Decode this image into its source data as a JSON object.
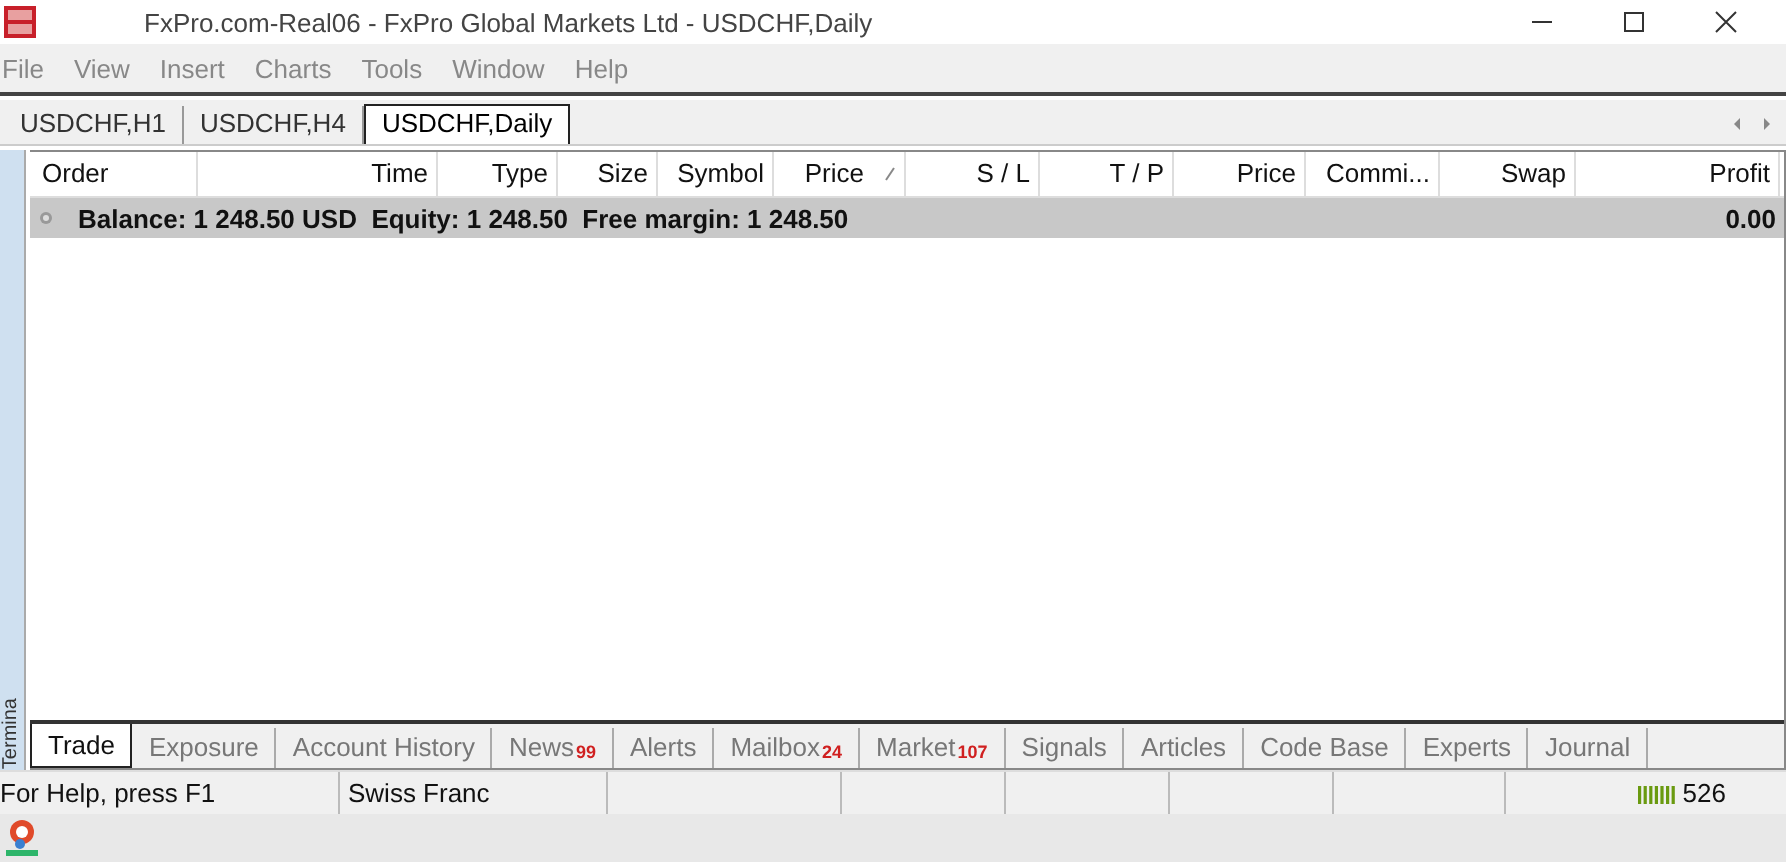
{
  "window": {
    "title": "FxPro.com-Real06 - FxPro Global Markets Ltd - USDCHF,Daily"
  },
  "menu": [
    "File",
    "View",
    "Insert",
    "Charts",
    "Tools",
    "Window",
    "Help"
  ],
  "chart_tabs": [
    {
      "label": "USDCHF,H1",
      "selected": false
    },
    {
      "label": "USDCHF,H4",
      "selected": false
    },
    {
      "label": "USDCHF,Daily",
      "selected": true
    }
  ],
  "terminal": {
    "side_label": "Termina",
    "columns": [
      {
        "label": "Order",
        "sorted": false
      },
      {
        "label": "Time",
        "sorted": false
      },
      {
        "label": "Type",
        "sorted": false
      },
      {
        "label": "Size",
        "sorted": false
      },
      {
        "label": "Symbol",
        "sorted": false
      },
      {
        "label": "Price",
        "sorted": true
      },
      {
        "label": "S / L",
        "sorted": false
      },
      {
        "label": "T / P",
        "sorted": false
      },
      {
        "label": "Price",
        "sorted": false
      },
      {
        "label": "Commi...",
        "sorted": false
      },
      {
        "label": "Swap",
        "sorted": false
      },
      {
        "label": "Profit",
        "sorted": false
      }
    ],
    "summary": {
      "text": "Balance: 1 248.50 USD  Equity: 1 248.50  Free margin: 1 248.50",
      "profit": "0.00"
    },
    "tabs": [
      {
        "label": "Trade",
        "selected": true
      },
      {
        "label": "Exposure",
        "selected": false
      },
      {
        "label": "Account History",
        "selected": false
      },
      {
        "label": "News",
        "badge": "99",
        "selected": false
      },
      {
        "label": "Alerts",
        "selected": false
      },
      {
        "label": "Mailbox",
        "badge": "24",
        "selected": false
      },
      {
        "label": "Market",
        "badge": "107",
        "selected": false
      },
      {
        "label": "Signals",
        "selected": false
      },
      {
        "label": "Articles",
        "selected": false
      },
      {
        "label": "Code Base",
        "selected": false
      },
      {
        "label": "Experts",
        "selected": false
      },
      {
        "label": "Journal",
        "selected": false
      }
    ]
  },
  "status_bar": {
    "help": "For Help, press F1",
    "symbol": "Swiss Franc",
    "traffic": "526"
  }
}
